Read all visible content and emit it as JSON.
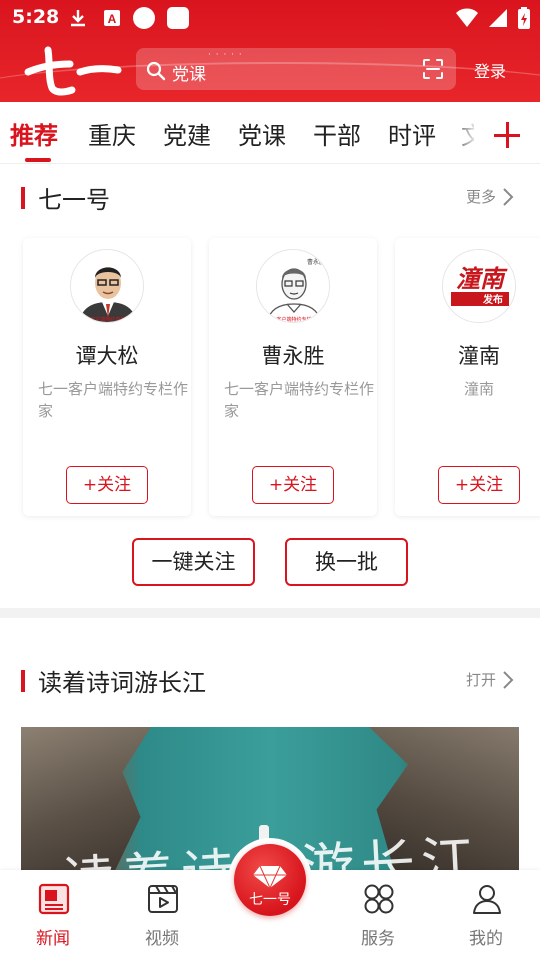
{
  "status_bar": {
    "time": "5:28"
  },
  "header": {
    "logo_text": "七一",
    "search_placeholder": "党课",
    "search_dots": "· · · · ·",
    "login_label": "登录"
  },
  "tabs": [
    "推荐",
    "重庆",
    "党建",
    "党课",
    "干部",
    "时评",
    "文"
  ],
  "qiyi_section": {
    "title": "七一号",
    "more_label": "更多",
    "cards": [
      {
        "name": "谭大松",
        "desc": "七一客户端特约专栏作家",
        "follow_label": "+关注"
      },
      {
        "name": "曹永胜",
        "desc": "七一客户端特约专栏作家",
        "follow_label": "+关注"
      },
      {
        "name": "潼南",
        "desc": "潼南",
        "follow_label": "+关注",
        "logo_text": "潼南",
        "logo_sub": "发布"
      }
    ],
    "follow_all_label": "一键关注",
    "refresh_label": "换一批"
  },
  "poem_section": {
    "title": "读着诗词游长江",
    "open_label": "打开",
    "banner_text": "读着诗词游长江"
  },
  "bottom_nav": {
    "items": [
      {
        "label": "新闻",
        "icon": "news-icon",
        "active": true
      },
      {
        "label": "视频",
        "icon": "video-icon",
        "active": false
      },
      {
        "label": "服务",
        "icon": "services-icon",
        "active": false
      },
      {
        "label": "我的",
        "icon": "profile-icon",
        "active": false
      }
    ],
    "center_label": "七一号"
  },
  "colors": {
    "brand_red": "#d9141e",
    "text_gray": "#999999"
  }
}
